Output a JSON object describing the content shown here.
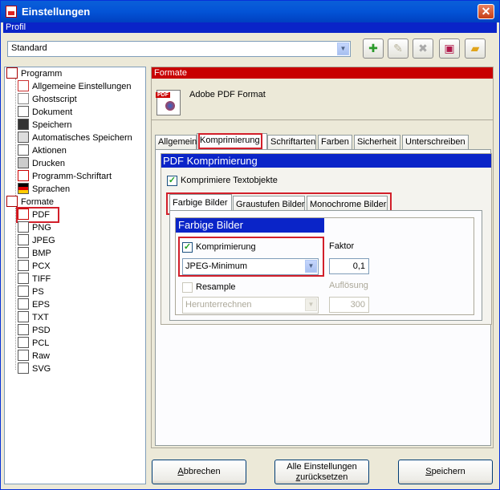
{
  "window": {
    "title": "Einstellungen",
    "close_glyph": "✕"
  },
  "profil": {
    "label": "Profil",
    "value": "Standard"
  },
  "toolbar": {
    "icons": [
      "add-profile-icon",
      "rename-profile-icon",
      "delete-profile-icon",
      "save-icon",
      "open-folder-icon"
    ]
  },
  "tree": {
    "programm": "Programm",
    "programm_items": [
      "Allgemeine Einstellungen",
      "Ghostscript",
      "Dokument",
      "Speichern",
      "Automatisches Speichern",
      "Aktionen",
      "Drucken",
      "Programm-Schriftart",
      "Sprachen"
    ],
    "formate": "Formate",
    "formate_items": [
      "PDF",
      "PNG",
      "JPEG",
      "BMP",
      "PCX",
      "TIFF",
      "PS",
      "EPS",
      "TXT",
      "PSD",
      "PCL",
      "Raw",
      "SVG"
    ]
  },
  "panel": {
    "section": "Formate",
    "header_title": "Adobe PDF Format"
  },
  "tabs": [
    "Allgemein",
    "Komprimierung",
    "Schriftarten",
    "Farben",
    "Sicherheit",
    "Unterschreiben"
  ],
  "compression": {
    "group_title": "PDF Komprimierung",
    "compress_text_label": "Komprimiere Textobjekte",
    "subtabs": [
      "Farbige Bilder",
      "Graustufen Bilder",
      "Monochrome Bilder"
    ],
    "inner_title": "Farbige Bilder",
    "compress_label": "Komprimierung",
    "method_value": "JPEG-Minimum",
    "factor_label": "Faktor",
    "factor_value": "0,1",
    "resample_label": "Resample",
    "resample_method": "Herunterrechnen",
    "resolution_label": "Auflösung",
    "resolution_value": "300"
  },
  "buttons": {
    "cancel_first": "A",
    "cancel_rest": "bbrechen",
    "reset_line1": "Alle Einstellungen",
    "reset_line2_pre": "z",
    "reset_line2_rest": "urücksetzen",
    "save_first": "S",
    "save_rest": "peichern"
  },
  "colors": {
    "title_blue": "#0a5fd9",
    "section_red": "#c80000",
    "group_blue": "#0a24c8",
    "highlight_red": "#d21f2a"
  }
}
